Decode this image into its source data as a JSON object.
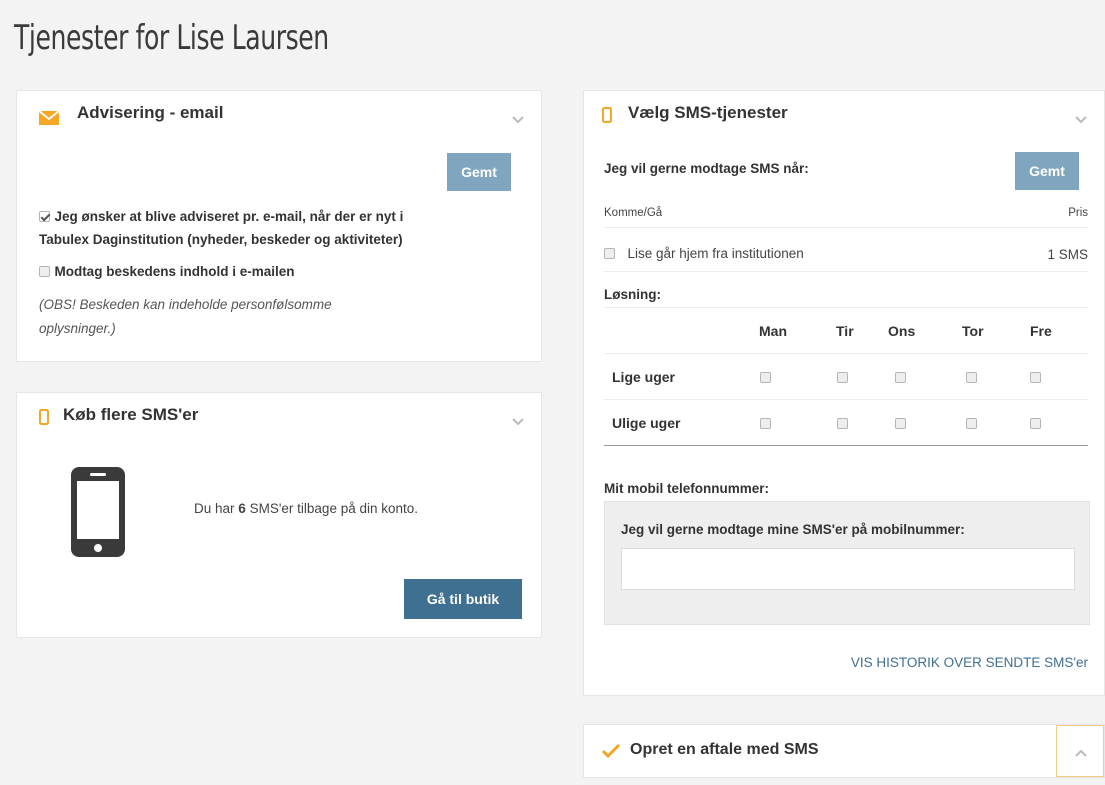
{
  "page": {
    "title": "Tjenester for Lise Laursen"
  },
  "email_panel": {
    "title": "Advisering - email",
    "save_label": "Gemt",
    "option_1_text": "Jeg ønsker at blive adviseret pr. e-mail, når der er nyt i Tabulex Daginstitution (nyheder, beskeder og aktiviteter)",
    "option_1_line1": "Jeg ønsker at blive adviseret pr. e-mail, når der er nyt i",
    "option_1_line2": "Tabulex Daginstitution (nyheder, beskeder og aktiviteter)",
    "option_1_checked": true,
    "option_2_text": "Modtag beskedens indhold i e-mailen",
    "option_2_checked": false,
    "note_line1": "(OBS! Beskeden kan indeholde personfølsomme",
    "note_line2": "oplysninger.)"
  },
  "buy_panel": {
    "title": "Køb flere SMS'er",
    "balance_prefix": "Du har",
    "balance_count": "6",
    "balance_suffix": "SMS'er tilbage på din konto.",
    "shop_label": "Gå til butik"
  },
  "sms_panel": {
    "title": "Vælg SMS-tjenester",
    "intro": "Jeg vil gerne modtage SMS når:",
    "save_label": "Gemt",
    "col_category": "Komme/Gå",
    "col_price": "Pris",
    "service_label": "Lise går hjem fra institutionen",
    "service_price": "1 SMS",
    "service_checked": false,
    "solution_label": "Løsning:",
    "days": [
      "Man",
      "Tir",
      "Ons",
      "Tor",
      "Fre"
    ],
    "rows": [
      "Lige uger",
      "Ulige uger"
    ],
    "phone_heading": "Mit mobil telefonnummer:",
    "phone_prompt": "Jeg vil gerne modtage mine SMS'er på mobilnummer:",
    "phone_value": "",
    "history_link": "VIS HISTORIK OVER SENDTE SMS'er"
  },
  "agreement_panel": {
    "title": "Opret en aftale med SMS"
  },
  "colors": {
    "accent_orange": "#f5a623",
    "button_light": "#7fa5bf",
    "button_dark": "#3f6f91",
    "link_blue": "#3f6f91"
  }
}
